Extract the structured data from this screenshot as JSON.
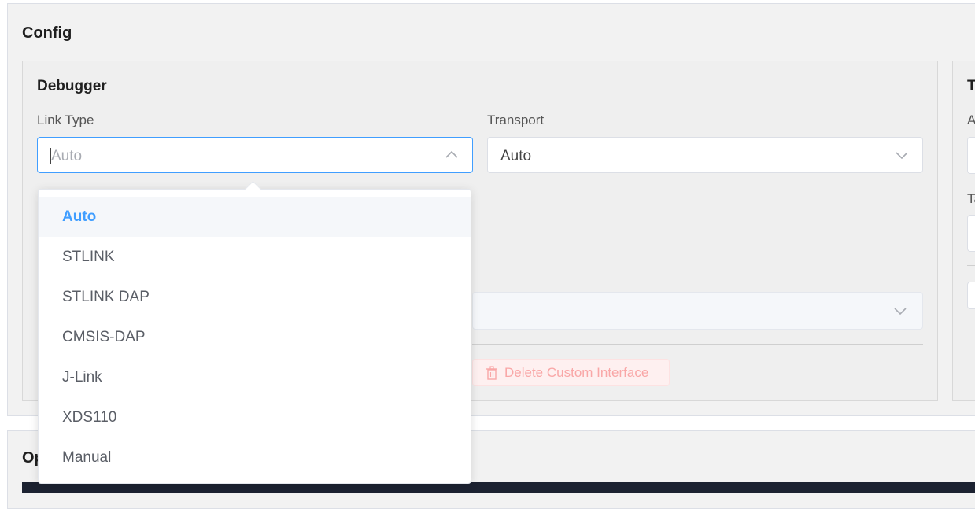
{
  "config": {
    "title": "Config"
  },
  "debugger": {
    "title": "Debugger",
    "link_type": {
      "label": "Link Type",
      "placeholder": "Auto"
    },
    "transport": {
      "label": "Transport",
      "value": "Auto"
    },
    "delete_button": {
      "label": "Delete Custom Interface",
      "icon": "trash-icon"
    }
  },
  "right_panel": {
    "title_fragment": "T",
    "labels": [
      "A",
      "Ta"
    ]
  },
  "link_type_dropdown": {
    "options": [
      "Auto",
      "STLINK",
      "STLINK DAP",
      "CMSIS-DAP",
      "J-Link",
      "XDS110",
      "Manual"
    ],
    "selected": "Auto"
  },
  "ops": {
    "title_fragment": "Op"
  },
  "colors": {
    "accent": "#409eff",
    "danger_light": "#f9a7a7",
    "terminal_bg": "#1c2231"
  }
}
